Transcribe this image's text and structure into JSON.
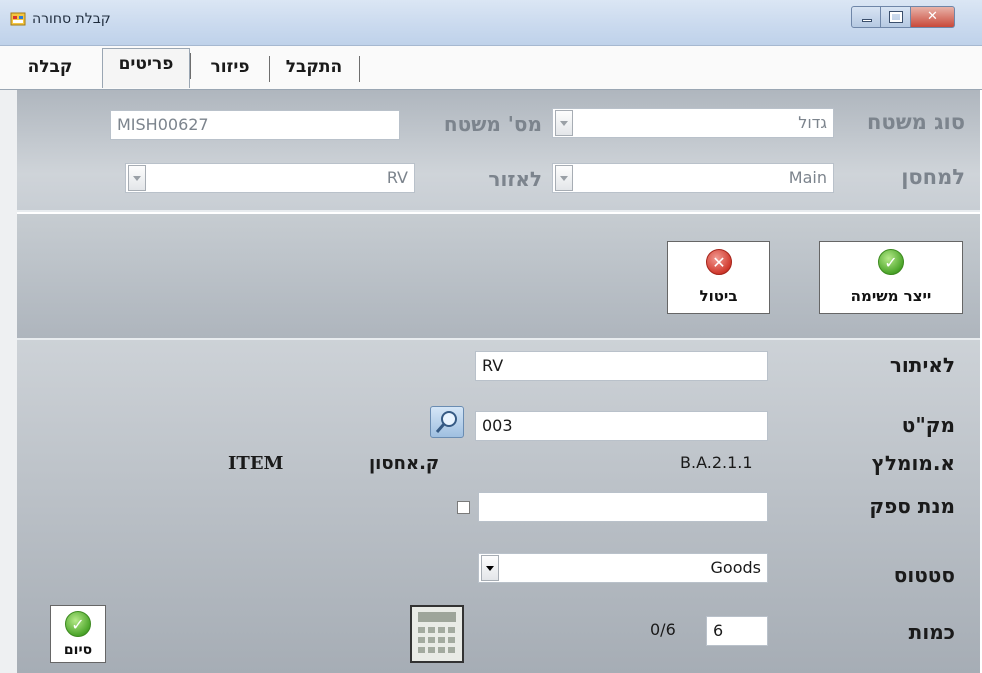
{
  "window": {
    "title": "קבלת סחורה",
    "icon": "app-form-icon",
    "controls": [
      "minimize-icon",
      "maximize-icon",
      "close-icon"
    ]
  },
  "tabs": [
    {
      "label": "קבלה",
      "active": false
    },
    {
      "label": "פריטים",
      "active": true
    },
    {
      "label": "פיזור",
      "active": false
    },
    {
      "label": "התקבל",
      "active": false
    }
  ],
  "header": {
    "pallet_type_label": "סוג משטח",
    "pallet_type_value": "גדול",
    "pallet_no_label": "מס' משטח",
    "pallet_no_value": "MISH00627",
    "to_warehouse_label": "למחסן",
    "to_warehouse_value": "Main",
    "to_zone_label": "לאזור",
    "to_zone_value": "RV"
  },
  "actions": {
    "create_task_label": "ייצר משימה",
    "cancel_label": "ביטול",
    "finish_label": "סיום"
  },
  "form": {
    "location_label": "לאיתור",
    "location_value": "RV",
    "sku_label": "מק\"ט",
    "sku_value": "003",
    "recommended_label": "א.מומלץ",
    "recommended_value": "B.A.2.1.1",
    "last_wh_label": "ק.אחסון",
    "last_wh_value": "ITEM",
    "supplier_batch_label": "מנת ספק",
    "supplier_batch_value": "",
    "status_label": "סטטוס",
    "status_value": "Goods",
    "quantity_label": "כמות",
    "quantity_value": "6",
    "quantity_progress": "0/6"
  },
  "colors": {
    "accent_green": "#4ca52a",
    "accent_red": "#d03a2e",
    "panel_grey": "#b8bec5"
  }
}
